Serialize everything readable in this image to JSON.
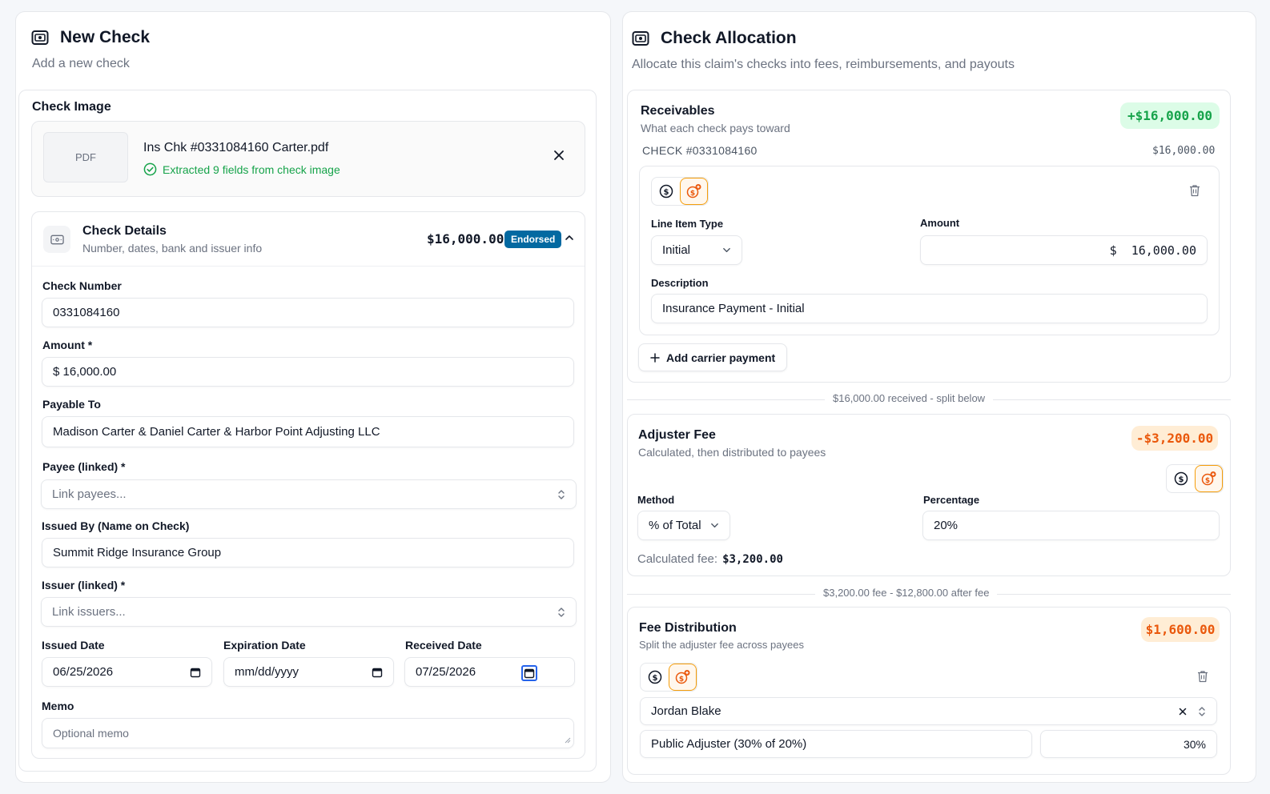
{
  "left": {
    "title": "New Check",
    "subtitle": "Add a new check",
    "check_image": {
      "heading": "Check Image",
      "thumb_label": "PDF",
      "filename": "Ins Chk #0331084160 Carter.pdf",
      "status": "Extracted 9 fields from check image"
    },
    "details": {
      "title": "Check Details",
      "subtitle": "Number, dates, bank and issuer info",
      "amount": "$16,000.00",
      "badge": "Endorsed"
    },
    "fields": {
      "check_number_label": "Check Number",
      "check_number": "0331084160",
      "amount_label": "Amount *",
      "amount": "$ 16,000.00",
      "payable_label": "Payable To",
      "payable": "Madison Carter & Daniel Carter & Harbor Point Adjusting LLC",
      "payee_label": "Payee (linked) *",
      "payee_placeholder": "Link payees...",
      "issued_by_label": "Issued By (Name on Check)",
      "issued_by": "Summit Ridge Insurance Group",
      "issuer_label": "Issuer (linked) *",
      "issuer_placeholder": "Link issuers...",
      "issued_date_label": "Issued Date",
      "issued_date": "06/25/2026",
      "expiration_label": "Expiration Date",
      "expiration": "mm/dd/yyyy",
      "received_label": "Received Date",
      "received": "07/25/2026",
      "memo_label": "Memo",
      "memo_placeholder": "Optional memo"
    }
  },
  "right": {
    "title": "Check Allocation",
    "subtitle": "Allocate this claim's checks into fees, reimbursements, and payouts",
    "receivables": {
      "title": "Receivables",
      "subtitle": "What each check pays toward",
      "total": "+$16,000.00",
      "check_label": "CHECK #0331084160",
      "check_amount": "$16,000.00",
      "line_item_type_label": "Line Item Type",
      "line_item_type": "Initial",
      "amount_label": "Amount",
      "amount": "$  16,000.00",
      "description_label": "Description",
      "description": "Insurance Payment - Initial",
      "add_button": "Add carrier payment"
    },
    "divider1": "$16,000.00 received - split below",
    "adjuster_fee": {
      "title": "Adjuster Fee",
      "subtitle": "Calculated, then distributed to payees",
      "total": "-$3,200.00",
      "method_label": "Method",
      "method": "% of Total",
      "percentage_label": "Percentage",
      "percentage": "20%",
      "calc_label": "Calculated fee:",
      "calc_value": "$3,200.00"
    },
    "divider2": "$3,200.00 fee - $12,800.00 after fee",
    "fee_distribution": {
      "title": "Fee Distribution",
      "subtitle": "Split the adjuster fee across payees",
      "total": "$1,600.00",
      "payee": "Jordan Blake",
      "role": "Public Adjuster (30% of 20%)",
      "percent": "30%"
    }
  },
  "colors": {
    "green": "#16a34a",
    "orange": "#ea580c",
    "blue_badge": "#0369a1"
  }
}
